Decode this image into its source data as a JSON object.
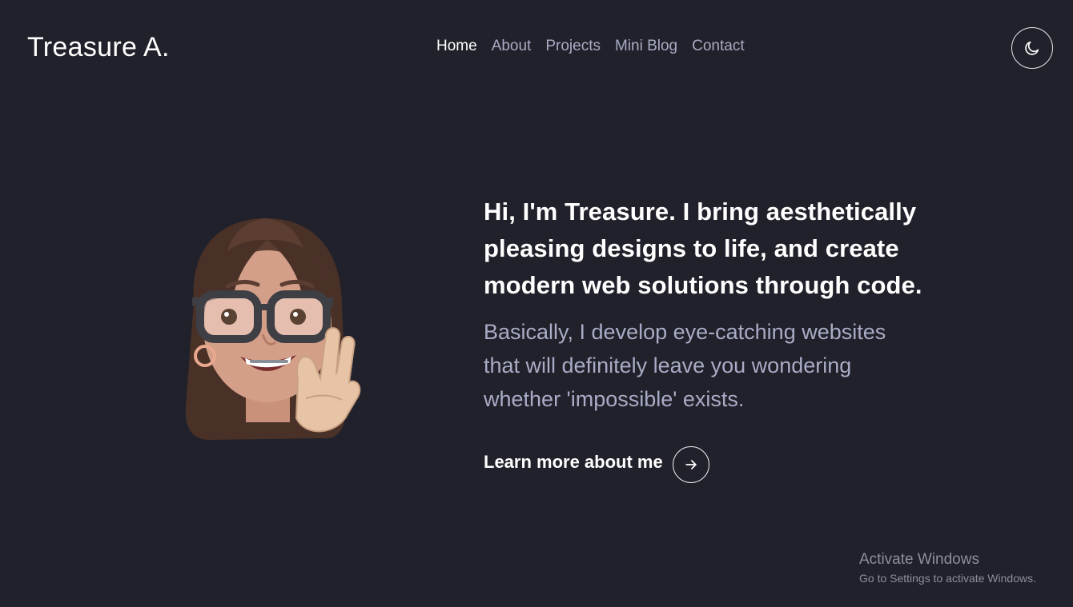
{
  "header": {
    "brand": "Treasure A.",
    "nav": [
      {
        "label": "Home",
        "active": true
      },
      {
        "label": "About",
        "active": false
      },
      {
        "label": "Projects",
        "active": false
      },
      {
        "label": "Mini Blog",
        "active": false
      },
      {
        "label": "Contact",
        "active": false
      }
    ],
    "theme_toggle_icon": "moon-icon"
  },
  "hero": {
    "headline": "Hi, I'm Treasure. I bring aesthetically pleasing designs to life, and create modern web solutions through code.",
    "subtext": "Basically, I develop eye-catching websites that will definitely leave you wondering whether 'impossible' exists.",
    "cta_label": "Learn more about me",
    "cta_icon": "arrow-right-icon",
    "avatar_icon": "memoji-avatar-icon"
  },
  "watermark": {
    "title": "Activate Windows",
    "subtitle": "Go to Settings to activate Windows."
  },
  "colors": {
    "background": "#20212a",
    "text_primary": "#ffffff",
    "text_muted": "#a9acc6"
  }
}
